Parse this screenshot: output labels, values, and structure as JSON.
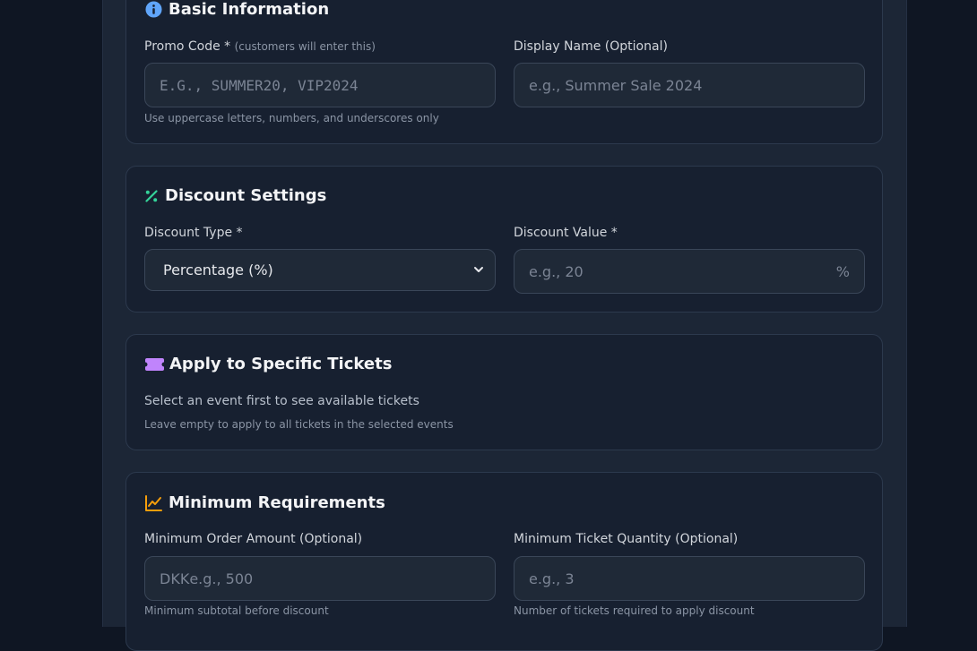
{
  "basic_info": {
    "title": "Basic Information",
    "promo_code": {
      "label": "Promo Code *",
      "hint": "(customers will enter this)",
      "placeholder": "E.G., SUMMER20, VIP2024",
      "help": "Use uppercase letters, numbers, and underscores only"
    },
    "display_name": {
      "label": "Display Name (Optional)",
      "placeholder": "e.g., Summer Sale 2024"
    }
  },
  "discount_settings": {
    "title": "Discount Settings",
    "discount_type": {
      "label": "Discount Type *",
      "selected": "Percentage (%)"
    },
    "discount_value": {
      "label": "Discount Value *",
      "placeholder": "e.g., 20",
      "suffix": "%"
    }
  },
  "specific_tickets": {
    "title": "Apply to Specific Tickets",
    "message": "Select an event first to see available tickets",
    "help": "Leave empty to apply to all tickets in the selected events"
  },
  "minimum_requirements": {
    "title": "Minimum Requirements",
    "min_order": {
      "label": "Minimum Order Amount (Optional)",
      "prefix": "DKK",
      "placeholder": "e.g., 500",
      "help": "Minimum subtotal before discount"
    },
    "min_quantity": {
      "label": "Minimum Ticket Quantity (Optional)",
      "placeholder": "e.g., 3",
      "help": "Number of tickets required to apply discount"
    }
  },
  "colors": {
    "info_icon": "#60a5fa",
    "percent_icon": "#34d399",
    "ticket_icon": "#c084fc",
    "chart_icon": "#f59e0b"
  },
  "icons": {
    "basic_info": "info-circle-icon",
    "discount_settings": "percent-icon",
    "specific_tickets": "ticket-icon",
    "minimum_requirements": "trending-up-icon",
    "select": "chevron-down-icon"
  }
}
